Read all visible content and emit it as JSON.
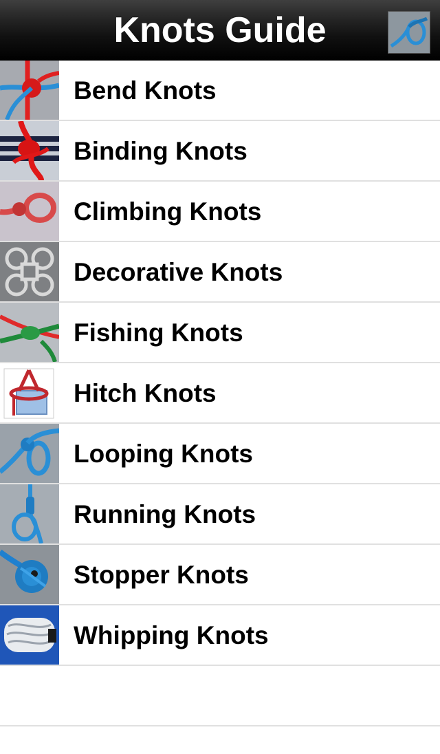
{
  "navbar": {
    "title": "Knots Guide",
    "thumb_icon": "blue-loop-knot-icon"
  },
  "categories": [
    {
      "label": "Bend Knots",
      "icon": "bend-knot-icon"
    },
    {
      "label": "Binding Knots",
      "icon": "binding-knot-icon"
    },
    {
      "label": "Climbing Knots",
      "icon": "climbing-knot-icon"
    },
    {
      "label": "Decorative Knots",
      "icon": "decorative-knot-icon"
    },
    {
      "label": "Fishing Knots",
      "icon": "fishing-knot-icon"
    },
    {
      "label": "Hitch Knots",
      "icon": "hitch-knot-icon"
    },
    {
      "label": "Looping Knots",
      "icon": "looping-knot-icon"
    },
    {
      "label": "Running Knots",
      "icon": "running-knot-icon"
    },
    {
      "label": "Stopper Knots",
      "icon": "stopper-knot-icon"
    },
    {
      "label": "Whipping Knots",
      "icon": "whipping-knot-icon"
    }
  ],
  "colors": {
    "navbar_bg": "#111111",
    "separator": "#e0e0e0",
    "rope_blue": "#2a8fd6",
    "rope_red": "#e02020",
    "rope_green": "#1f8a3a"
  }
}
